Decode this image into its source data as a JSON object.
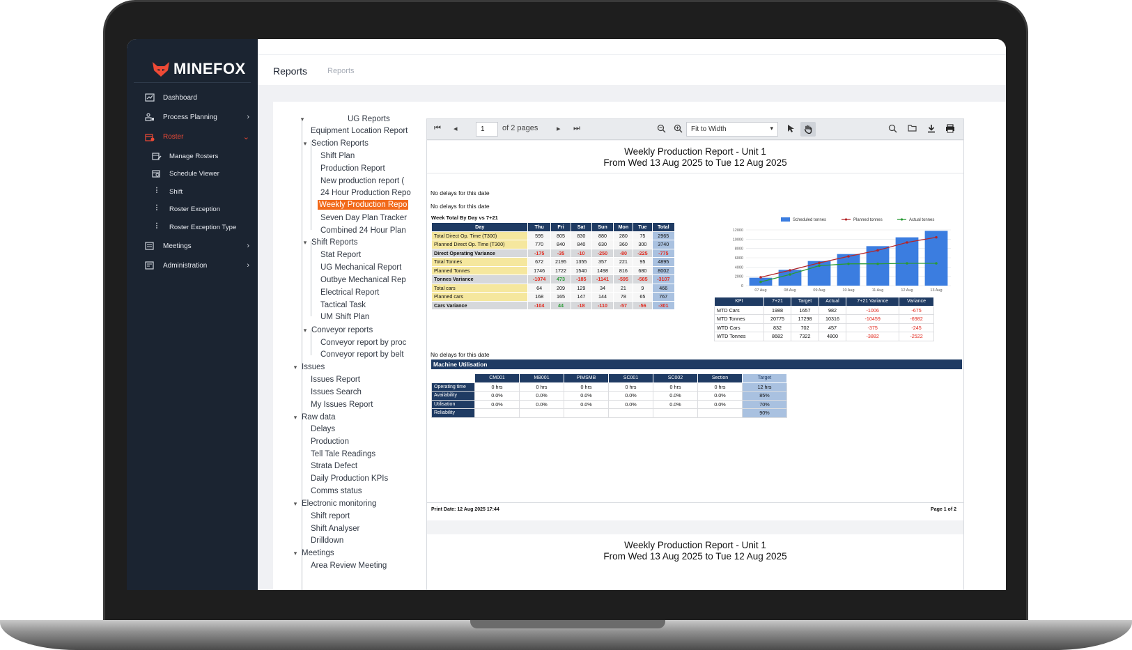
{
  "app": {
    "brand": "MINEFOX",
    "brand_color": "#ef4a36"
  },
  "sidebar": {
    "items": [
      {
        "label": "Dashboard",
        "icon": "chart-icon"
      },
      {
        "label": "Process Planning",
        "icon": "process-icon"
      },
      {
        "label": "Roster",
        "icon": "roster-icon",
        "active": true
      },
      {
        "label": "Meetings",
        "icon": "calendar-icon"
      },
      {
        "label": "Administration",
        "icon": "admin-icon"
      }
    ],
    "roster_sub": [
      {
        "label": "Manage Rosters",
        "icon": "calendar-edit-icon"
      },
      {
        "label": "Schedule Viewer",
        "icon": "calendar-view-icon"
      },
      {
        "label": "Shift",
        "icon": "dots-icon"
      },
      {
        "label": "Roster Exception",
        "icon": "dots-icon"
      },
      {
        "label": "Roster Exception Type",
        "icon": "dots-icon"
      }
    ]
  },
  "header": {
    "title": "Reports",
    "breadcrumb": "Reports"
  },
  "tree": {
    "root": "UG Reports",
    "equipment": "Equipment Location Report",
    "section_reports": "Section Reports",
    "section_items": [
      "Shift Plan",
      "Production Report",
      "New production report (",
      "24 Hour Production Repo",
      "Weekly Production Repo",
      "Seven Day Plan Tracker",
      "Combined 24 Hour Plan"
    ],
    "shift_reports": "Shift Reports",
    "shift_items": [
      "Stat Report",
      "UG Mechanical Report",
      "Outbye Mechanical Rep",
      "Electrical Report",
      "Tactical Task",
      "UM Shift Plan"
    ],
    "conveyor_reports": "Conveyor reports",
    "conveyor_items": [
      "Conveyor report by proc",
      "Conveyor report by belt"
    ],
    "issues": "Issues",
    "issues_items": [
      "Issues Report",
      "Issues Search",
      "My Issues Report"
    ],
    "raw_data": "Raw data",
    "raw_items": [
      "Delays",
      "Production",
      "Tell Tale Readings",
      "Strata Defect",
      "Daily Production KPIs",
      "Comms status"
    ],
    "electronic": "Electronic monitoring",
    "electronic_items": [
      "Shift report",
      "Shift Analyser",
      "Drilldown"
    ],
    "meetings": "Meetings",
    "meetings_items": [
      "Area Review Meeting"
    ]
  },
  "viewer": {
    "page_input": "1",
    "page_of": "of 2 pages",
    "zoom": "Fit to Width",
    "report_title": "Weekly Production Report - Unit 1",
    "report_range": "From Wed 13 Aug 2025 to Tue 12 Aug 2025",
    "no_delays": "No delays for this date",
    "week_title": "Week Total By Day vs 7+21",
    "week_headers": [
      "Day",
      "Thu",
      "Fri",
      "Sat",
      "Sun",
      "Mon",
      "Tue",
      "Total"
    ],
    "week_rows": [
      {
        "label": "Total Direct Op. Time (T300)",
        "vals": [
          "595",
          "805",
          "830",
          "880",
          "280",
          "75",
          "2965"
        ],
        "style": "yel"
      },
      {
        "label": "Planned Direct Op. Time (T300)",
        "vals": [
          "770",
          "840",
          "840",
          "630",
          "360",
          "300",
          "3740"
        ],
        "style": "yel"
      },
      {
        "label": "Direct Operating Variance",
        "vals": [
          "-175",
          "-35",
          "-10",
          "-250",
          "-80",
          "-225",
          "-775"
        ],
        "style": "gry",
        "neg": true
      },
      {
        "label": "Total Tonnes",
        "vals": [
          "672",
          "2195",
          "1355",
          "357",
          "221",
          "95",
          "4895"
        ],
        "style": "yel"
      },
      {
        "label": "Planned Tonnes",
        "vals": [
          "1746",
          "1722",
          "1540",
          "1498",
          "816",
          "680",
          "8002"
        ],
        "style": "yel"
      },
      {
        "label": "Tonnes Variance",
        "vals": [
          "-1074",
          "473",
          "-185",
          "-1141",
          "-595",
          "-585",
          "-3107"
        ],
        "style": "gry",
        "mixed": true
      },
      {
        "label": "Total cars",
        "vals": [
          "64",
          "209",
          "129",
          "34",
          "21",
          "9",
          "466"
        ],
        "style": "yel"
      },
      {
        "label": "Planned cars",
        "vals": [
          "168",
          "165",
          "147",
          "144",
          "78",
          "65",
          "767"
        ],
        "style": "yel"
      },
      {
        "label": "Cars Variance",
        "vals": [
          "-104",
          "44",
          "-18",
          "-110",
          "-57",
          "-56",
          "-301"
        ],
        "style": "gry",
        "mixed": true
      }
    ],
    "kpi_headers": [
      "KPI",
      "7+21",
      "Target",
      "Actual",
      "7+21 Variance",
      "Variance"
    ],
    "kpi_rows": [
      [
        "MTD Cars",
        "1988",
        "1657",
        "982",
        "-1006",
        "-675"
      ],
      [
        "MTD Tonnes",
        "20775",
        "17298",
        "10316",
        "-10459",
        "-6982"
      ],
      [
        "WTD Cars",
        "832",
        "702",
        "457",
        "-375",
        "-245"
      ],
      [
        "WTD Tonnes",
        "8682",
        "7322",
        "4800",
        "-3882",
        "-2522"
      ]
    ],
    "mu_title": "Machine Utilisation",
    "mu_headers": [
      "CM001",
      "MB001",
      "PIMSMB",
      "SC001",
      "SC002",
      "Section",
      "Target"
    ],
    "mu_rows": [
      {
        "label": "Operating time",
        "vals": [
          "0 hrs",
          "0 hrs",
          "0 hrs",
          "0 hrs",
          "0 hrs",
          "0 hrs",
          "12 hrs"
        ]
      },
      {
        "label": "Availability",
        "vals": [
          "0.0%",
          "0.0%",
          "0.0%",
          "0.0%",
          "0.0%",
          "0.0%",
          "85%"
        ]
      },
      {
        "label": "Utilisation",
        "vals": [
          "0.0%",
          "0.0%",
          "0.0%",
          "0.0%",
          "0.0%",
          "0.0%",
          "70%"
        ]
      },
      {
        "label": "Reliability",
        "vals": [
          "",
          "",
          "",
          "",
          "",
          "",
          "90%"
        ]
      }
    ],
    "print_date": "Print Date: 12 Aug 2025 17:44",
    "page_label": "Page 1 of 2"
  },
  "chart_data": {
    "type": "bar",
    "categories": [
      "08 Aug",
      "09 Aug",
      "10 Aug",
      "11 Aug",
      "12 Aug",
      "13 Aug"
    ],
    "ylim": [
      0,
      12000
    ],
    "yticks": [
      "0",
      "2000",
      "4000",
      "6000",
      "8000",
      "10000",
      "12000"
    ],
    "legend_position": "top",
    "series": [
      {
        "name": "Scheduled tonnes",
        "kind": "bar",
        "color": "#3b7de0",
        "values": [
          1700,
          3400,
          5300,
          6800,
          8500,
          10400,
          11800
        ]
      },
      {
        "name": "Planned tonnes",
        "kind": "line",
        "color": "#b3262a",
        "values": [
          1800,
          3300,
          4900,
          6300,
          7600,
          9300,
          10400
        ]
      },
      {
        "name": "Actual tonnes",
        "kind": "line",
        "color": "#2a9a36",
        "values": [
          800,
          2400,
          4300,
          4700,
          4700,
          4800,
          4800
        ]
      }
    ],
    "x_labels": [
      "07 Aug",
      "08 Aug",
      "09 Aug",
      "10 Aug",
      "11 Aug",
      "12 Aug",
      "13 Aug"
    ]
  }
}
